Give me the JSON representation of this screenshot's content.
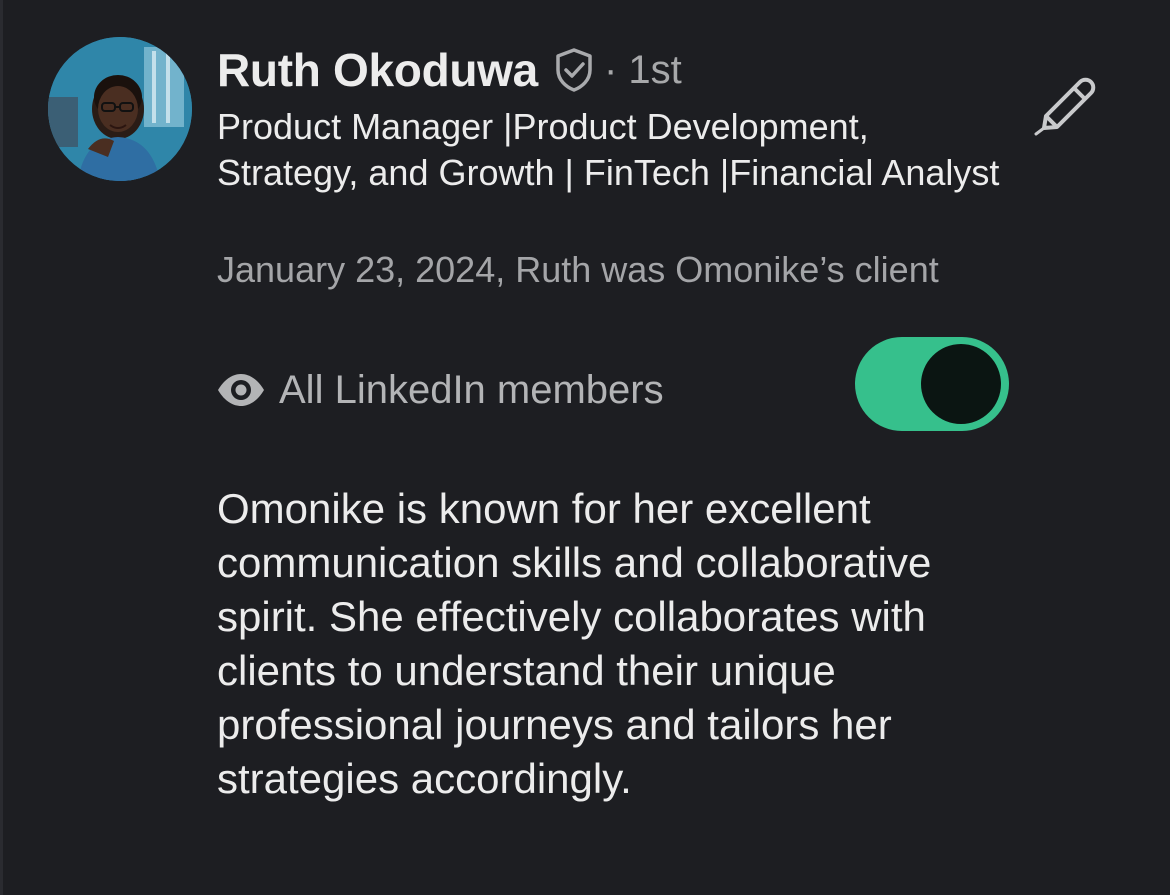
{
  "profile": {
    "name": "Ruth Okoduwa",
    "verified_icon": "shield-check-icon",
    "connection_degree": "· 1st",
    "headline": "Product Manager |Product Development, Strategy, and Growth | FinTech |Financial Analyst",
    "relationship": "January 23, 2024, Ruth was Omonike’s client",
    "avatar_icon": "profile-photo"
  },
  "visibility": {
    "icon": "eye-icon",
    "label": "All LinkedIn members",
    "enabled": true
  },
  "edit": {
    "icon": "pencil-icon"
  },
  "recommendation": {
    "text": "Omonike is known for her excellent communication skills and collaborative spirit. She effectively collaborates with clients to understand their unique professional journeys and tailors her strategies accordingly."
  },
  "colors": {
    "background": "#1d1e22",
    "toggle_on": "#36c08c",
    "toggle_knob": "#0b1512",
    "primary_text": "#ececec",
    "secondary_text": "#a4a5a8"
  }
}
